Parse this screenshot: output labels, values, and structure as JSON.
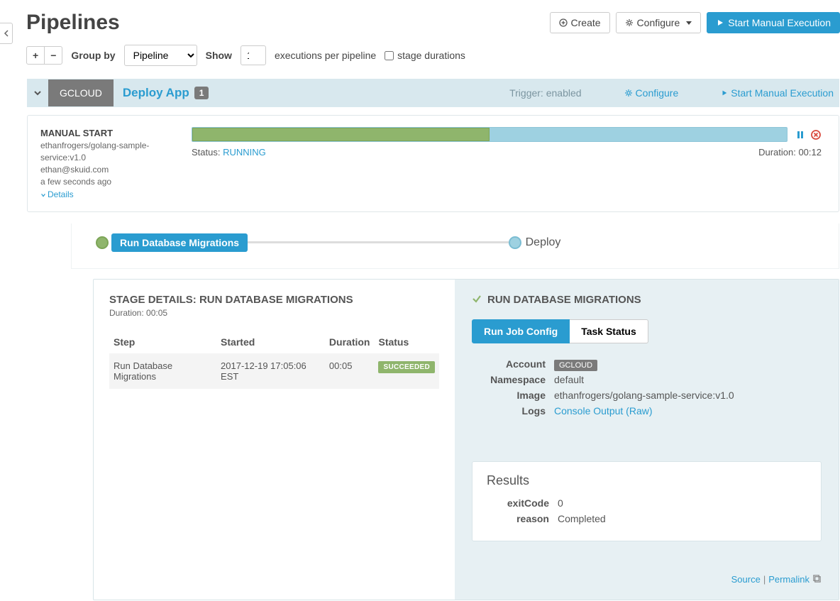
{
  "page_title": "Pipelines",
  "header_buttons": {
    "create": "Create",
    "configure": "Configure",
    "start_manual": "Start Manual Execution"
  },
  "filters": {
    "group_by_label": "Group by",
    "group_by_value": "Pipeline",
    "show_label": "Show",
    "show_value": "1",
    "show_suffix": "executions per pipeline",
    "stage_durations_label": "stage durations"
  },
  "pipeline": {
    "account": "GCLOUD",
    "name": "Deploy App",
    "count": "1",
    "trigger_label": "Trigger: enabled",
    "configure": "Configure",
    "start_manual": "Start Manual Execution"
  },
  "execution": {
    "title": "MANUAL START",
    "image": "ethanfrogers/golang-sample-service:v1.0",
    "user": "ethan@skuid.com",
    "age": "a few seconds ago",
    "details_link": "Details",
    "status_label": "Status: ",
    "status_value": "RUNNING",
    "duration_label": "Duration: ",
    "duration_value": "00:12"
  },
  "stages": {
    "stage1": "Run Database Migrations",
    "stage2": "Deploy"
  },
  "stage_details": {
    "title": "STAGE DETAILS: RUN DATABASE MIGRATIONS",
    "duration": "Duration: 00:05",
    "columns": {
      "step": "Step",
      "started": "Started",
      "duration": "Duration",
      "status": "Status"
    },
    "row": {
      "step": "Run Database Migrations",
      "started": "2017-12-19 17:05:06 EST",
      "duration": "00:05",
      "status": "SUCCEEDED"
    }
  },
  "stage_panel": {
    "title": "RUN DATABASE MIGRATIONS",
    "tabs": {
      "config": "Run Job Config",
      "task": "Task Status"
    },
    "fields": {
      "account_k": "Account",
      "account_v": "GCLOUD",
      "namespace_k": "Namespace",
      "namespace_v": "default",
      "image_k": "Image",
      "image_v": "ethanfrogers/golang-sample-service:v1.0",
      "logs_k": "Logs",
      "logs_v": "Console Output (Raw)"
    },
    "results": {
      "title": "Results",
      "exitcode_k": "exitCode",
      "exitcode_v": "0",
      "reason_k": "reason",
      "reason_v": "Completed"
    },
    "footer": {
      "source": "Source",
      "permalink": "Permalink"
    }
  }
}
